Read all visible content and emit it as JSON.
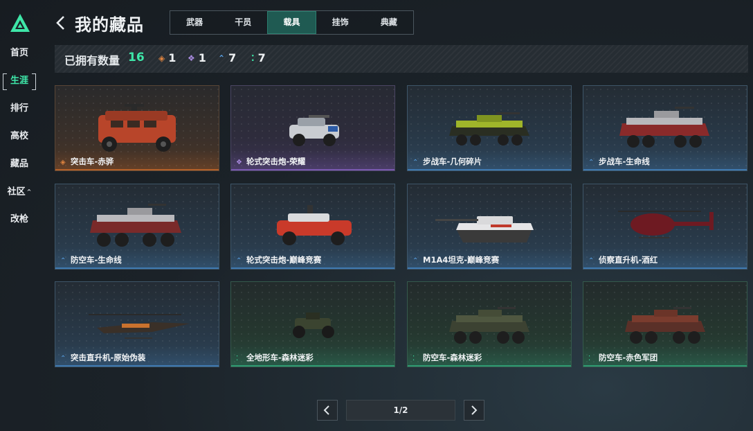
{
  "sidebar": {
    "items": [
      {
        "label": "首页",
        "active": false
      },
      {
        "label": "生涯",
        "active": true
      },
      {
        "label": "排行",
        "active": false
      },
      {
        "label": "高校",
        "active": false
      },
      {
        "label": "藏品",
        "active": false
      },
      {
        "label": "社区",
        "active": false,
        "caret": "^"
      },
      {
        "label": "改枪",
        "active": false
      }
    ],
    "logo_icon": "triangle-logo-icon",
    "accent": "#3ee6a8"
  },
  "header": {
    "back_icon": "chevron-left-icon",
    "title": "我的藏品",
    "tabs": [
      {
        "label": "武器",
        "active": false
      },
      {
        "label": "干员",
        "active": false
      },
      {
        "label": "载具",
        "active": true
      },
      {
        "label": "挂饰",
        "active": false
      },
      {
        "label": "典藏",
        "active": false
      }
    ]
  },
  "stats": {
    "owned_label": "已拥有数量",
    "owned_total": "16",
    "by_rarity": [
      {
        "rarity": "orange",
        "icon": "diamond-icon",
        "color": "#e0843f",
        "count": "1"
      },
      {
        "rarity": "purple",
        "icon": "diamond-cluster-icon",
        "color": "#a98be0",
        "count": "1"
      },
      {
        "rarity": "blue",
        "icon": "chevron-up-icon",
        "color": "#5aa2e6",
        "count": "7"
      },
      {
        "rarity": "green",
        "icon": "dots-icon",
        "color": "#3ee6a8",
        "count": "7"
      }
    ]
  },
  "vehicles": [
    {
      "name": "突击车-赤骅",
      "rarity": "orange"
    },
    {
      "name": "轮式突击炮-荣耀",
      "rarity": "purple"
    },
    {
      "name": "步战车-几何碎片",
      "rarity": "blue"
    },
    {
      "name": "步战车-生命线",
      "rarity": "blue"
    },
    {
      "name": "防空车-生命线",
      "rarity": "blue"
    },
    {
      "name": "轮式突击炮-巅峰竞赛",
      "rarity": "blue"
    },
    {
      "name": "M1A4坦克-巅峰竞赛",
      "rarity": "blue"
    },
    {
      "name": "侦察直升机-酒红",
      "rarity": "blue"
    },
    {
      "name": "突击直升机-原始伪装",
      "rarity": "blue"
    },
    {
      "name": "全地形车-森林迷彩",
      "rarity": "green"
    },
    {
      "name": "防空车-森林迷彩",
      "rarity": "green"
    },
    {
      "name": "防空车-赤色军团",
      "rarity": "green"
    }
  ],
  "pager": {
    "prev_icon": "chevron-left-icon",
    "next_icon": "chevron-right-icon",
    "page_text": "1/2"
  }
}
